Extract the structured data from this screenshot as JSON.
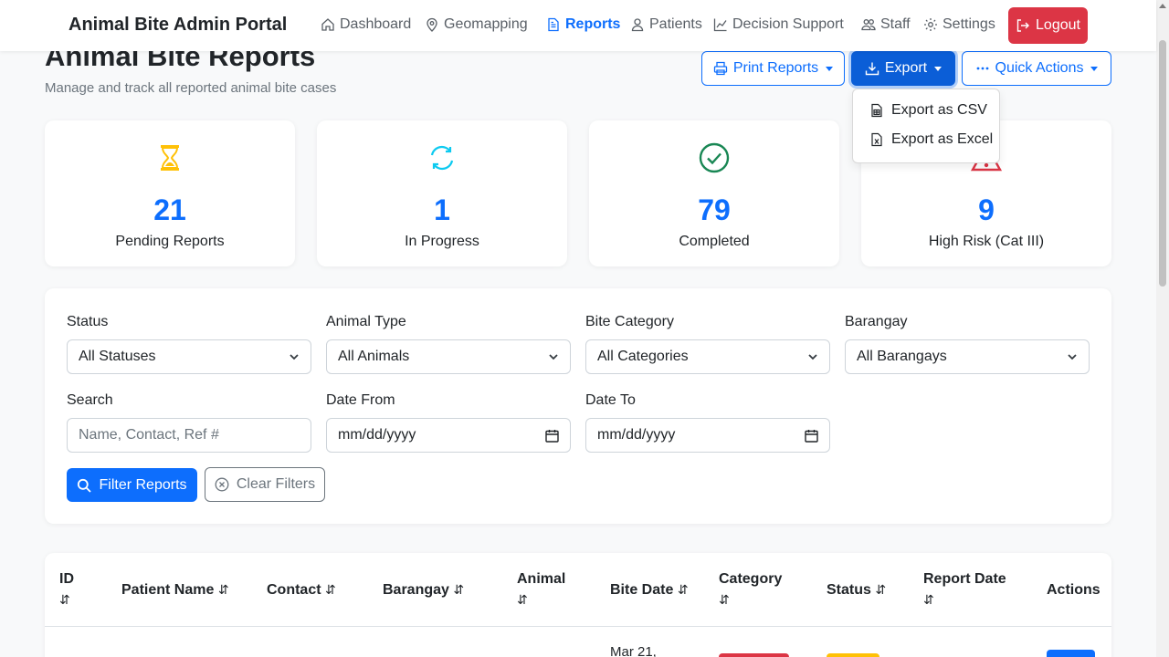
{
  "app": {
    "title": "Animal Bite Admin Portal"
  },
  "nav": {
    "items": [
      {
        "label": "Dashboard",
        "icon": "home-icon"
      },
      {
        "label": "Geomapping",
        "icon": "map-pin-icon"
      },
      {
        "label": "Reports",
        "icon": "document-icon",
        "active": true
      },
      {
        "label": "Patients",
        "icon": "user-icon"
      },
      {
        "label": "Decision Support",
        "icon": "chart-line-icon"
      },
      {
        "label": "Staff",
        "icon": "people-icon"
      },
      {
        "label": "Settings",
        "icon": "gear-icon"
      }
    ],
    "logout_label": "Logout"
  },
  "page": {
    "title": "Animal Bite Reports",
    "subtitle": "Manage and track all reported animal bite cases"
  },
  "toolbar": {
    "print_label": "Print Reports",
    "export_label": "Export",
    "quick_actions_label": "Quick Actions"
  },
  "export_menu": {
    "csv_label": "Export as CSV",
    "excel_label": "Export as Excel"
  },
  "stats": [
    {
      "value": "21",
      "label": "Pending Reports",
      "icon": "hourglass-icon",
      "color": "#ffc107"
    },
    {
      "value": "1",
      "label": "In Progress",
      "icon": "refresh-icon",
      "color": "#0dcaf0"
    },
    {
      "value": "79",
      "label": "Completed",
      "icon": "check-circle-icon",
      "color": "#198754"
    },
    {
      "value": "9",
      "label": "High Risk (Cat III)",
      "icon": "warning-icon",
      "color": "#dc3545"
    }
  ],
  "filters": {
    "status": {
      "label": "Status",
      "value": "All Statuses"
    },
    "animal_type": {
      "label": "Animal Type",
      "value": "All Animals"
    },
    "bite_category": {
      "label": "Bite Category",
      "value": "All Categories"
    },
    "barangay": {
      "label": "Barangay",
      "value": "All Barangays"
    },
    "search": {
      "label": "Search",
      "placeholder": "Name, Contact, Ref #"
    },
    "date_from": {
      "label": "Date From",
      "value": "mm/dd/yyyy"
    },
    "date_to": {
      "label": "Date To",
      "value": "mm/dd/yyyy"
    },
    "filter_button": "Filter Reports",
    "clear_button": "Clear Filters"
  },
  "table": {
    "columns": [
      "ID",
      "Patient Name",
      "Contact",
      "Barangay",
      "Animal",
      "Bite Date",
      "Category",
      "Status",
      "Report Date",
      "Actions"
    ],
    "sort_glyph": "⇵",
    "first_row_bite_date": "Mar 21,"
  },
  "colors": {
    "primary": "#0d6efd",
    "danger": "#dc3545",
    "warning": "#ffc107",
    "success": "#198754",
    "info": "#0dcaf0"
  }
}
